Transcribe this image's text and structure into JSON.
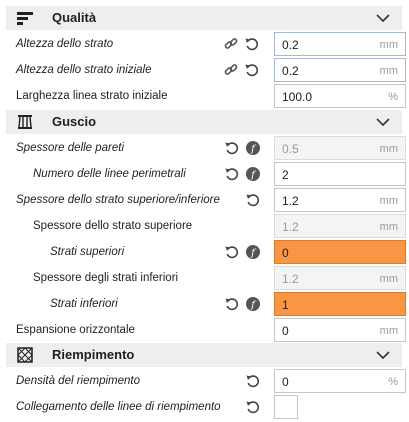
{
  "sections": {
    "quality": {
      "title": "Qualità",
      "icon": "quality-layers-icon"
    },
    "shell": {
      "title": "Guscio",
      "icon": "shell-icon"
    },
    "infill": {
      "title": "Riempimento",
      "icon": "infill-icon"
    }
  },
  "rows": {
    "layer_height": {
      "label": "Altezza dello strato",
      "value": "0.2",
      "unit": "mm"
    },
    "initial_layer_height": {
      "label": "Altezza dello strato iniziale",
      "value": "0.2",
      "unit": "mm"
    },
    "initial_line_width": {
      "label": "Larghezza linea strato iniziale",
      "value": "100.0",
      "unit": "%"
    },
    "wall_thickness": {
      "label": "Spessore delle pareti",
      "value": "0.5",
      "unit": "mm"
    },
    "wall_line_count": {
      "label": "Numero delle linee perimetrali",
      "value": "2",
      "unit": ""
    },
    "top_bottom_thickness": {
      "label": "Spessore dello strato superiore/inferiore",
      "value": "1.2",
      "unit": "mm"
    },
    "top_thickness": {
      "label": "Spessore dello strato superiore",
      "value": "1.2",
      "unit": "mm"
    },
    "top_layers": {
      "label": "Strati superiori",
      "value": "0",
      "unit": ""
    },
    "bottom_thickness": {
      "label": "Spessore degli strati inferiori",
      "value": "1.2",
      "unit": "mm"
    },
    "bottom_layers": {
      "label": "Strati inferiori",
      "value": "1",
      "unit": ""
    },
    "horizontal_expansion": {
      "label": "Espansione orizzontale",
      "value": "0",
      "unit": "mm"
    },
    "infill_density": {
      "label": "Densità del riempimento",
      "value": "0",
      "unit": "%"
    },
    "connect_infill_lines": {
      "label": "Collegamento delle linee di riempimento",
      "checked": false
    }
  },
  "colors": {
    "category_bg": "#eeeeee",
    "warning_field": "#f99646",
    "disabled_field": "#f4f4f4",
    "icon_gray": "#444444"
  }
}
